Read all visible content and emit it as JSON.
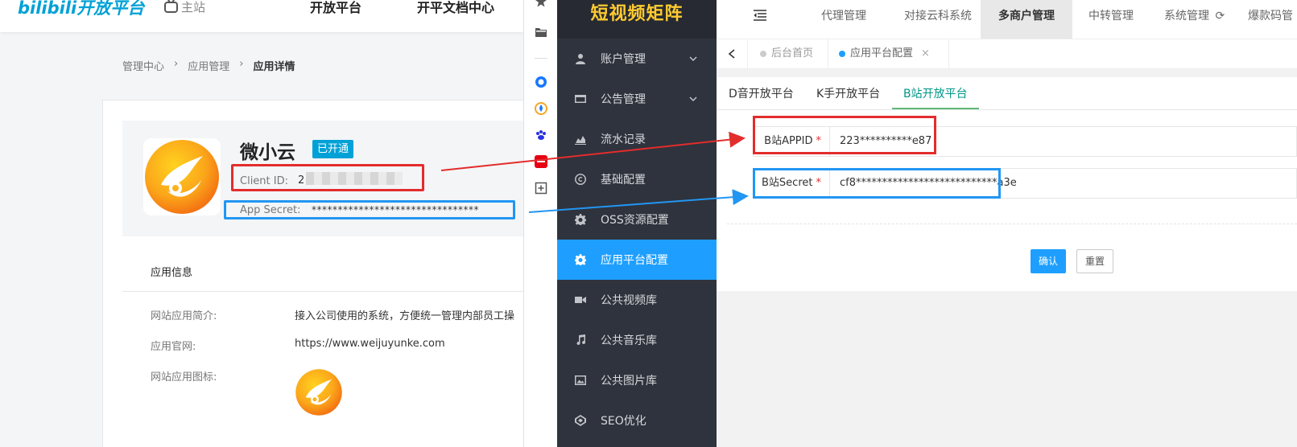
{
  "bili": {
    "logo": "bilibili开放平台",
    "home": "主站",
    "nav": [
      "开放平台",
      "开平文档中心"
    ],
    "breadcrumb": [
      "管理中心",
      "应用管理",
      "应用详情"
    ],
    "app_name": "微小云",
    "app_badge": "已开通",
    "client_id_label": "Client ID:",
    "client_id_value": "2",
    "app_secret_label": "App Secret:",
    "app_secret_value": "********************************",
    "info_title": "应用信息",
    "info": [
      {
        "label": "网站应用简介:",
        "value": "接入公司使用的系统，方便统一管理内部员工操"
      },
      {
        "label": "应用官网:",
        "value": "https://www.weijuyunke.com"
      },
      {
        "label": "网站应用图标:",
        "value": ""
      }
    ]
  },
  "admin": {
    "brand": "短视频矩阵",
    "menu": [
      {
        "label": "账户管理",
        "icon": "user-icon",
        "caret": true
      },
      {
        "label": "公告管理",
        "icon": "card-icon",
        "caret": true
      },
      {
        "label": "流水记录",
        "icon": "chart-icon",
        "caret": false
      },
      {
        "label": "基础配置",
        "icon": "copyright-icon",
        "caret": false
      },
      {
        "label": "OSS资源配置",
        "icon": "gear-icon",
        "caret": false
      },
      {
        "label": "应用平台配置",
        "icon": "gear-icon",
        "caret": false,
        "active": true
      },
      {
        "label": "公共视频库",
        "icon": "video-icon",
        "caret": false
      },
      {
        "label": "公共音乐库",
        "icon": "music-icon",
        "caret": false
      },
      {
        "label": "公共图片库",
        "icon": "image-icon",
        "caret": false
      },
      {
        "label": "SEO优化",
        "icon": "codepen-icon",
        "caret": false
      }
    ],
    "topnav": [
      "代理管理",
      "对接云科系统",
      "多商户管理",
      "中转管理",
      "系统管理",
      "爆款码管"
    ],
    "topnav_active": 2,
    "tabs": [
      {
        "label": "后台首页"
      },
      {
        "label": "应用平台配置"
      }
    ],
    "platform_tabs": [
      "D音开放平台",
      "K手开放平台",
      "B站开放平台"
    ],
    "platform_tab_active": 2,
    "fields": [
      {
        "label": "B站APPID",
        "value": "223**********e87"
      },
      {
        "label": "B站Secret",
        "value": "cf8***************************a3e"
      }
    ],
    "confirm_label": "确认",
    "reset_label": "重置"
  },
  "colors": {
    "bili_blue": "#00a1d6",
    "admin_accent": "#1e9fff",
    "sidebar_bg": "#2f333d",
    "highlight_red": "#e32c2c",
    "highlight_blue": "#2196f3"
  }
}
